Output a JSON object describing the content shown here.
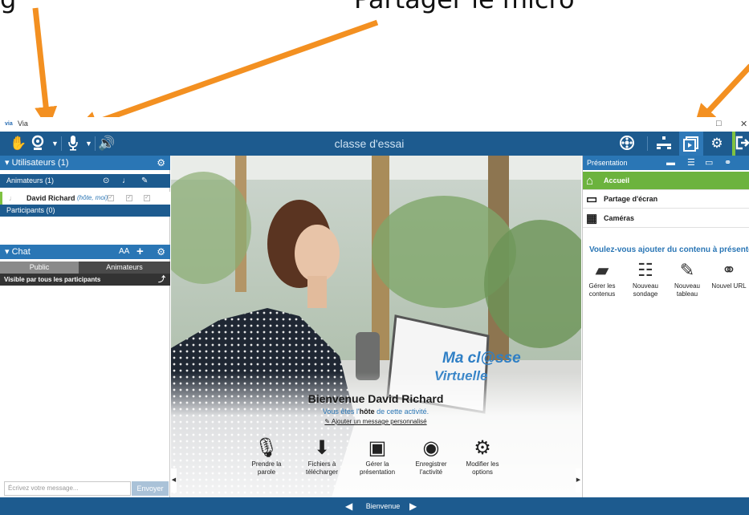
{
  "annotations": {
    "left_text": "g",
    "center_text": "Partager le micro",
    "arrow_color": "#f39021"
  },
  "window": {
    "app_logo": "via",
    "app_name": "Via",
    "restore_glyph": "□",
    "close_glyph": "✕"
  },
  "topbar": {
    "title": "classe d'essai",
    "icons": [
      "raise-hand-icon",
      "webcam-icon",
      "microphone-icon",
      "speaker-icon",
      "record-icon",
      "layout-icon",
      "presentation-icon",
      "settings-icon",
      "exit-icon"
    ]
  },
  "users": {
    "header": "Utilisateurs (1)",
    "animateurs_label": "Animateurs (1)",
    "user_name": "David Richard",
    "user_role": "(hôte, moi)",
    "participants_label": "Participants (0)"
  },
  "chat": {
    "header": "Chat",
    "font_size_label": "AA",
    "tab_public": "Public",
    "tab_animateurs": "Animateurs",
    "visibility": "Visible par tous les participants",
    "input_placeholder": "Écrivez votre message...",
    "send_label": "Envoyer"
  },
  "welcome": {
    "brand_line1": "Ma cl@sse",
    "brand_line2": "Virtuelle",
    "title": "Bienvenue David Richard",
    "host_prefix": "Vous êtes l'",
    "host_word": "hôte",
    "host_suffix": " de cette activité.",
    "custom_message": "Ajouter un message personnalisé",
    "actions": [
      {
        "label1": "Prendre la",
        "label2": "parole"
      },
      {
        "label1": "Fichiers à",
        "label2": "télécharger"
      },
      {
        "label1": "Gérer la",
        "label2": "présentation"
      },
      {
        "label1": "Enregistrer",
        "label2": "l'activité"
      },
      {
        "label1": "Modifier les",
        "label2": "options"
      }
    ]
  },
  "presentation": {
    "header": "Présentation",
    "items": [
      "Accueil",
      "Partage d'écran",
      "Caméras"
    ],
    "question": "Voulez-vous ajouter du contenu à présenter",
    "actions": [
      {
        "label1": "Gérer les",
        "label2": "contenus"
      },
      {
        "label1": "Nouveau",
        "label2": "sondage"
      },
      {
        "label1": "Nouveau",
        "label2": "tableau"
      },
      {
        "label1": "Nouvel URL",
        "label2": ""
      }
    ]
  },
  "bottom": {
    "label": "Bienvenue"
  }
}
